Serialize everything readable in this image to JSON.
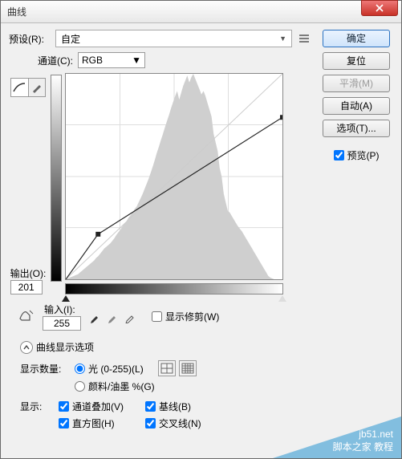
{
  "window": {
    "title": "曲线"
  },
  "buttons": {
    "ok": "确定",
    "reset": "复位",
    "smooth": "平滑(M)",
    "auto": "自动(A)",
    "options": "选项(T)..."
  },
  "preview": {
    "label": "预览(P)",
    "checked": true
  },
  "preset": {
    "label": "预设(R):",
    "value": "自定"
  },
  "channel": {
    "label": "通道(C):",
    "value": "RGB"
  },
  "output": {
    "label": "输出(O):",
    "value": "201"
  },
  "input": {
    "label": "输入(I):",
    "value": "255"
  },
  "show_clipping": {
    "label": "显示修剪(W)",
    "checked": false
  },
  "expander": {
    "label": "曲线显示选项"
  },
  "show_amount": {
    "label": "显示数量:",
    "opt_light": "光 (0-255)(L)",
    "opt_pigment": "颜料/油墨 %(G)",
    "selected": "light"
  },
  "show": {
    "label": "显示:",
    "channel_overlay": {
      "label": "通道叠加(V)",
      "checked": true
    },
    "baseline": {
      "label": "基线(B)",
      "checked": true
    },
    "histogram": {
      "label": "直方图(H)",
      "checked": true
    },
    "intersection": {
      "label": "交叉线(N)",
      "checked": true
    }
  },
  "watermark": {
    "line1": "jb51.net",
    "line2": "脚本之家 教程"
  },
  "chart_data": {
    "type": "line",
    "title": "",
    "xlabel": "输入",
    "ylabel": "输出",
    "xlim": [
      0,
      255
    ],
    "ylim": [
      0,
      255
    ],
    "curve_points": [
      {
        "x": 38,
        "y": 56
      },
      {
        "x": 255,
        "y": 201
      }
    ],
    "histogram": [
      0,
      1,
      2,
      3,
      4,
      5,
      6,
      8,
      10,
      12,
      14,
      16,
      18,
      20,
      22,
      25,
      27,
      30,
      33,
      36,
      38,
      40,
      42,
      45,
      48,
      52,
      55,
      58,
      62,
      65,
      68,
      72,
      75,
      78,
      82,
      85,
      90,
      95,
      100,
      106,
      112,
      118,
      125,
      132,
      140,
      148,
      155,
      163,
      170,
      178,
      185,
      192,
      200,
      207,
      214,
      220,
      210,
      218,
      226,
      232,
      238,
      230,
      236,
      240,
      234,
      228,
      222,
      216,
      220,
      214,
      206,
      198,
      190,
      170,
      160,
      150,
      130,
      120,
      100,
      90,
      80,
      78,
      74,
      70,
      66,
      62,
      59,
      56,
      52,
      48,
      44,
      40,
      36,
      32,
      28,
      24,
      20,
      16,
      12,
      8,
      4,
      2,
      1,
      0,
      0,
      0,
      0,
      0
    ]
  }
}
